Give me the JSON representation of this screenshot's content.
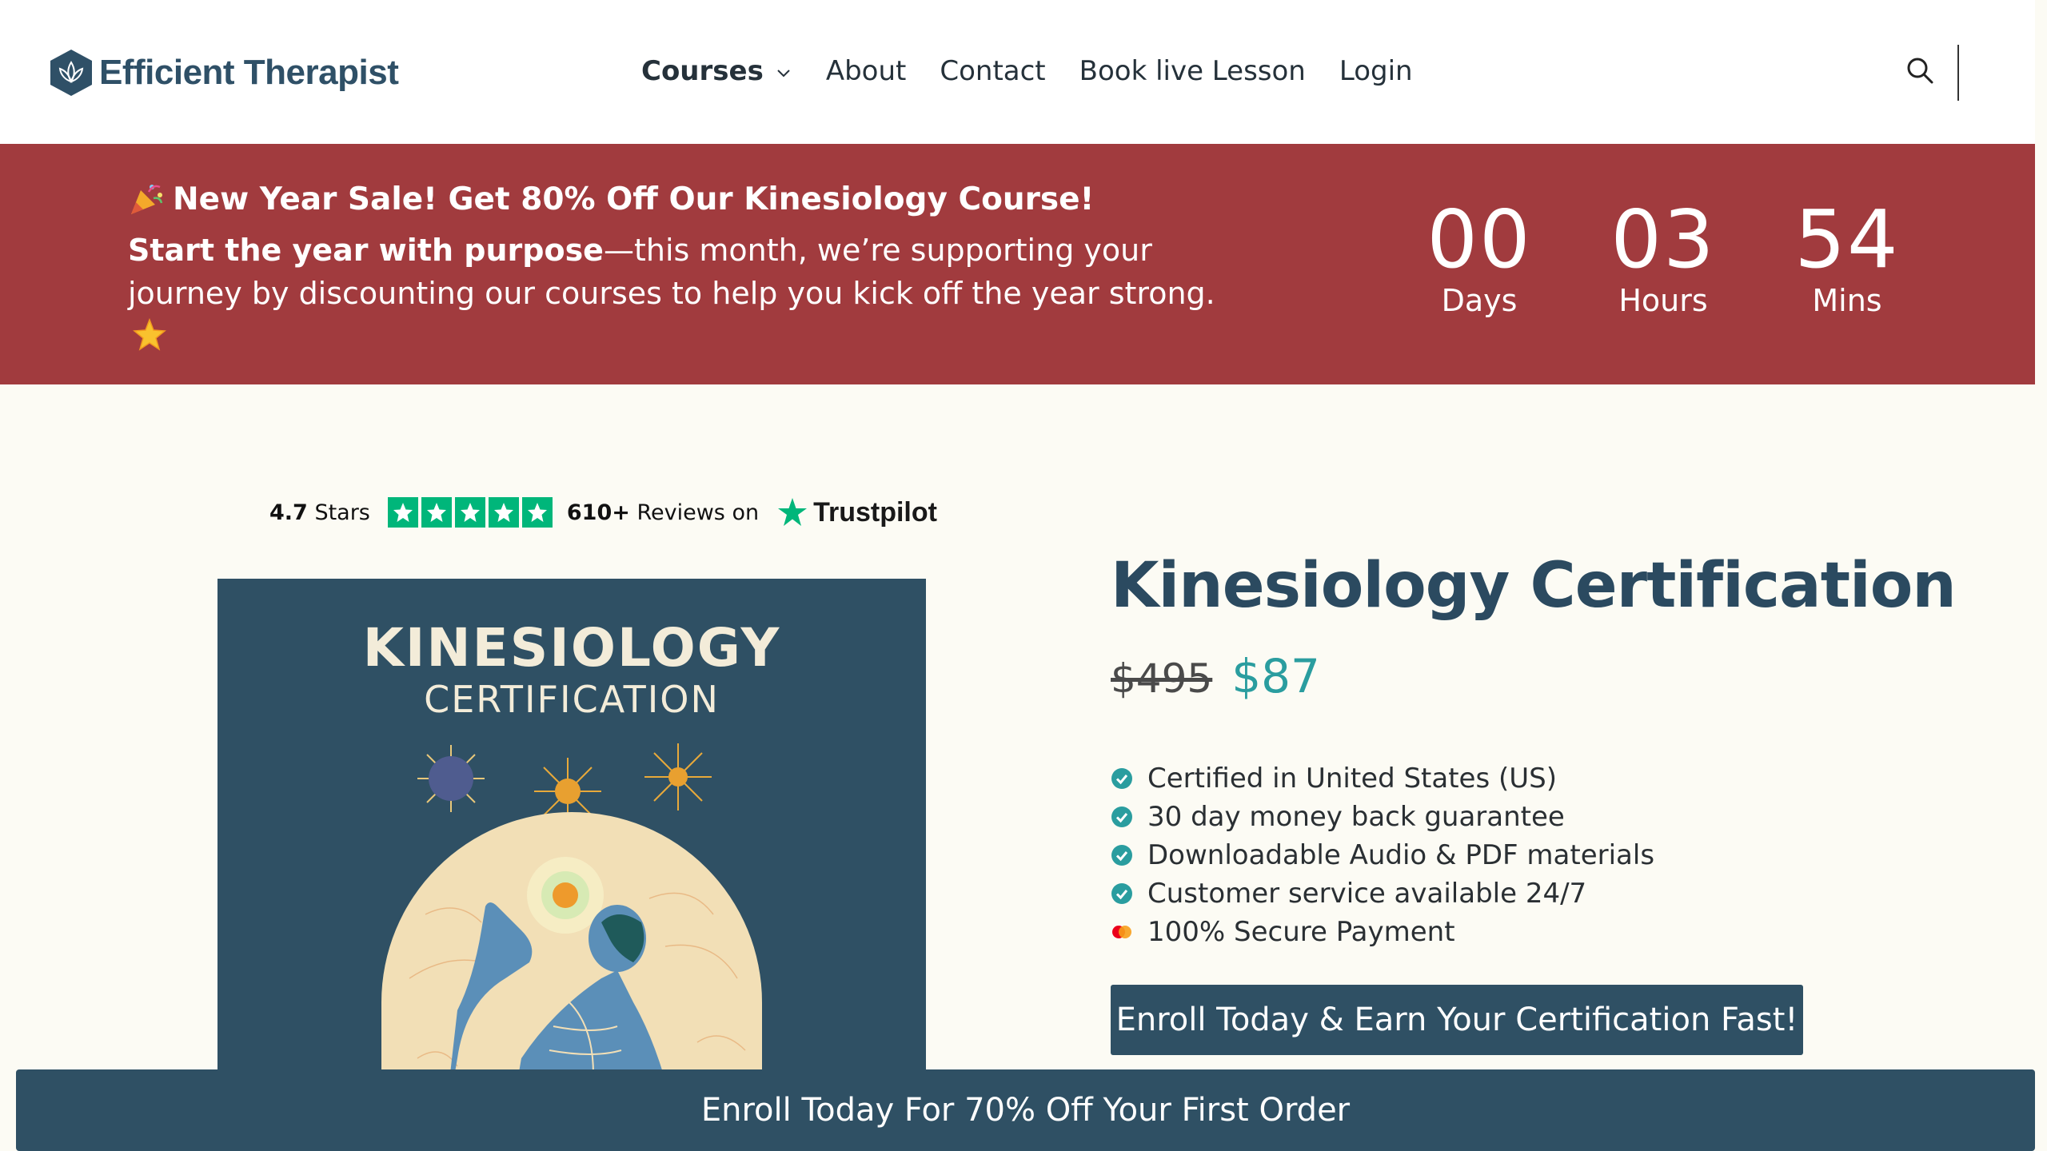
{
  "header": {
    "logo_text": "Efficient Therapist",
    "nav": [
      {
        "label": "Courses",
        "has_dropdown": true,
        "active": true
      },
      {
        "label": "About"
      },
      {
        "label": "Contact"
      },
      {
        "label": "Book live Lesson"
      },
      {
        "label": "Login"
      }
    ],
    "search_icon": "search-icon"
  },
  "banner": {
    "title": "New Year Sale! Get 80% Off Our Kinesiology Course!",
    "body_bold": "Start the year with purpose",
    "body_rest": "—this month, we’re supporting your journey by discounting our courses to help you kick off the year strong.",
    "countdown": {
      "days": {
        "value": "00",
        "label": "Days"
      },
      "hours": {
        "value": "03",
        "label": "Hours"
      },
      "mins": {
        "value": "54",
        "label": "Mins"
      }
    },
    "color": "#a13b3e"
  },
  "trustpilot": {
    "rating_value": "4.7",
    "rating_suffix": "Stars",
    "reviews_count": "610+",
    "reviews_suffix": "Reviews on",
    "brand": "Trustpilot",
    "stars": 5
  },
  "product_image": {
    "title": "KINESIOLOGY",
    "subtitle": "CERTIFICATION"
  },
  "product": {
    "title": "Kinesiology Certification",
    "old_price": "$495",
    "new_price": "$87",
    "features": [
      {
        "text": "Certified in United States (US)",
        "icon": "check-circle-icon"
      },
      {
        "text": "30 day money back guarantee",
        "icon": "check-circle-icon"
      },
      {
        "text": "Downloadable Audio & PDF materials",
        "icon": "check-circle-icon"
      },
      {
        "text": "Customer service available 24/7",
        "icon": "check-circle-icon"
      },
      {
        "text": "100% Secure Payment",
        "icon": "mastercard-icon"
      }
    ],
    "enroll_label": "Enroll Today & Earn Your Certification Fast!"
  },
  "sticky_bar": {
    "label": "Enroll Today For 70% Off Your First Order"
  },
  "colors": {
    "primary": "#2f5064",
    "accent": "#2a9d9f",
    "banner": "#a13b3e",
    "background": "#fcfbf4"
  }
}
